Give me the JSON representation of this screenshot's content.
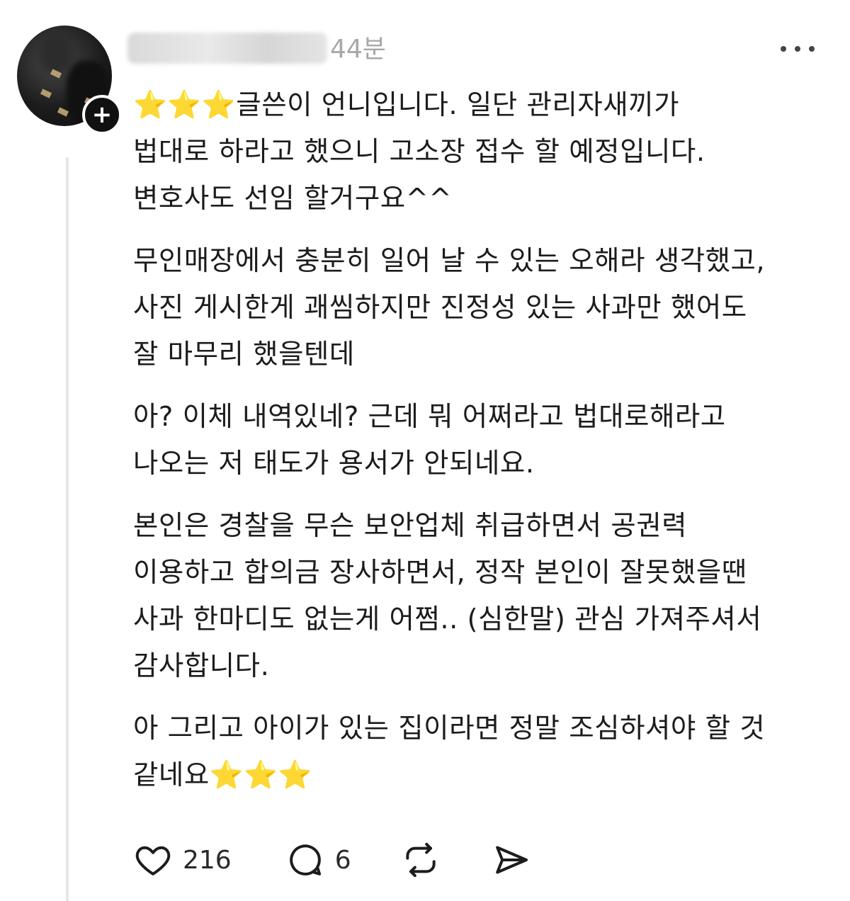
{
  "post": {
    "username": "kr_manjane",
    "time": "44분",
    "follow_symbol": "+",
    "paragraphs": [
      "⭐⭐⭐글쓴이 언니입니다. 일단 관리자새끼가\n법대로 하라고 했으니 고소장 접수 할 예정입니다.\n변호사도 선임 할거구요^^",
      "무인매장에서 충분히 일어 날 수 있는 오해라 생각했고,\n사진 게시한게 괘씸하지만 진정성 있는 사과만 했어도\n잘 마무리 했을텐데",
      "아? 이체 내역있네? 근데 뭐 어쩌라고 법대로해라고\n나오는 저 태도가 용서가 안되네요.",
      "본인은 경찰을 무슨 보안업체 취급하면서 공권력\n이용하고 합의금 장사하면서, 정작 본인이 잘못했을땐\n사과 한마디도 없는게 어쩜.. (심한말) 관심 가져주셔서\n감사합니다.",
      "아 그리고 아이가 있는 집이라면 정말 조심하셔야 할 것\n같네요⭐⭐⭐"
    ]
  },
  "actions": {
    "like_count": "216",
    "reply_count": "6",
    "icons": [
      "heart-icon",
      "comment-icon",
      "repost-icon",
      "share-icon"
    ]
  },
  "colors": {
    "text": "#1c1c1c",
    "muted": "#a8a8a8",
    "thread_line": "#e7e7e7",
    "badge": "#111111"
  }
}
